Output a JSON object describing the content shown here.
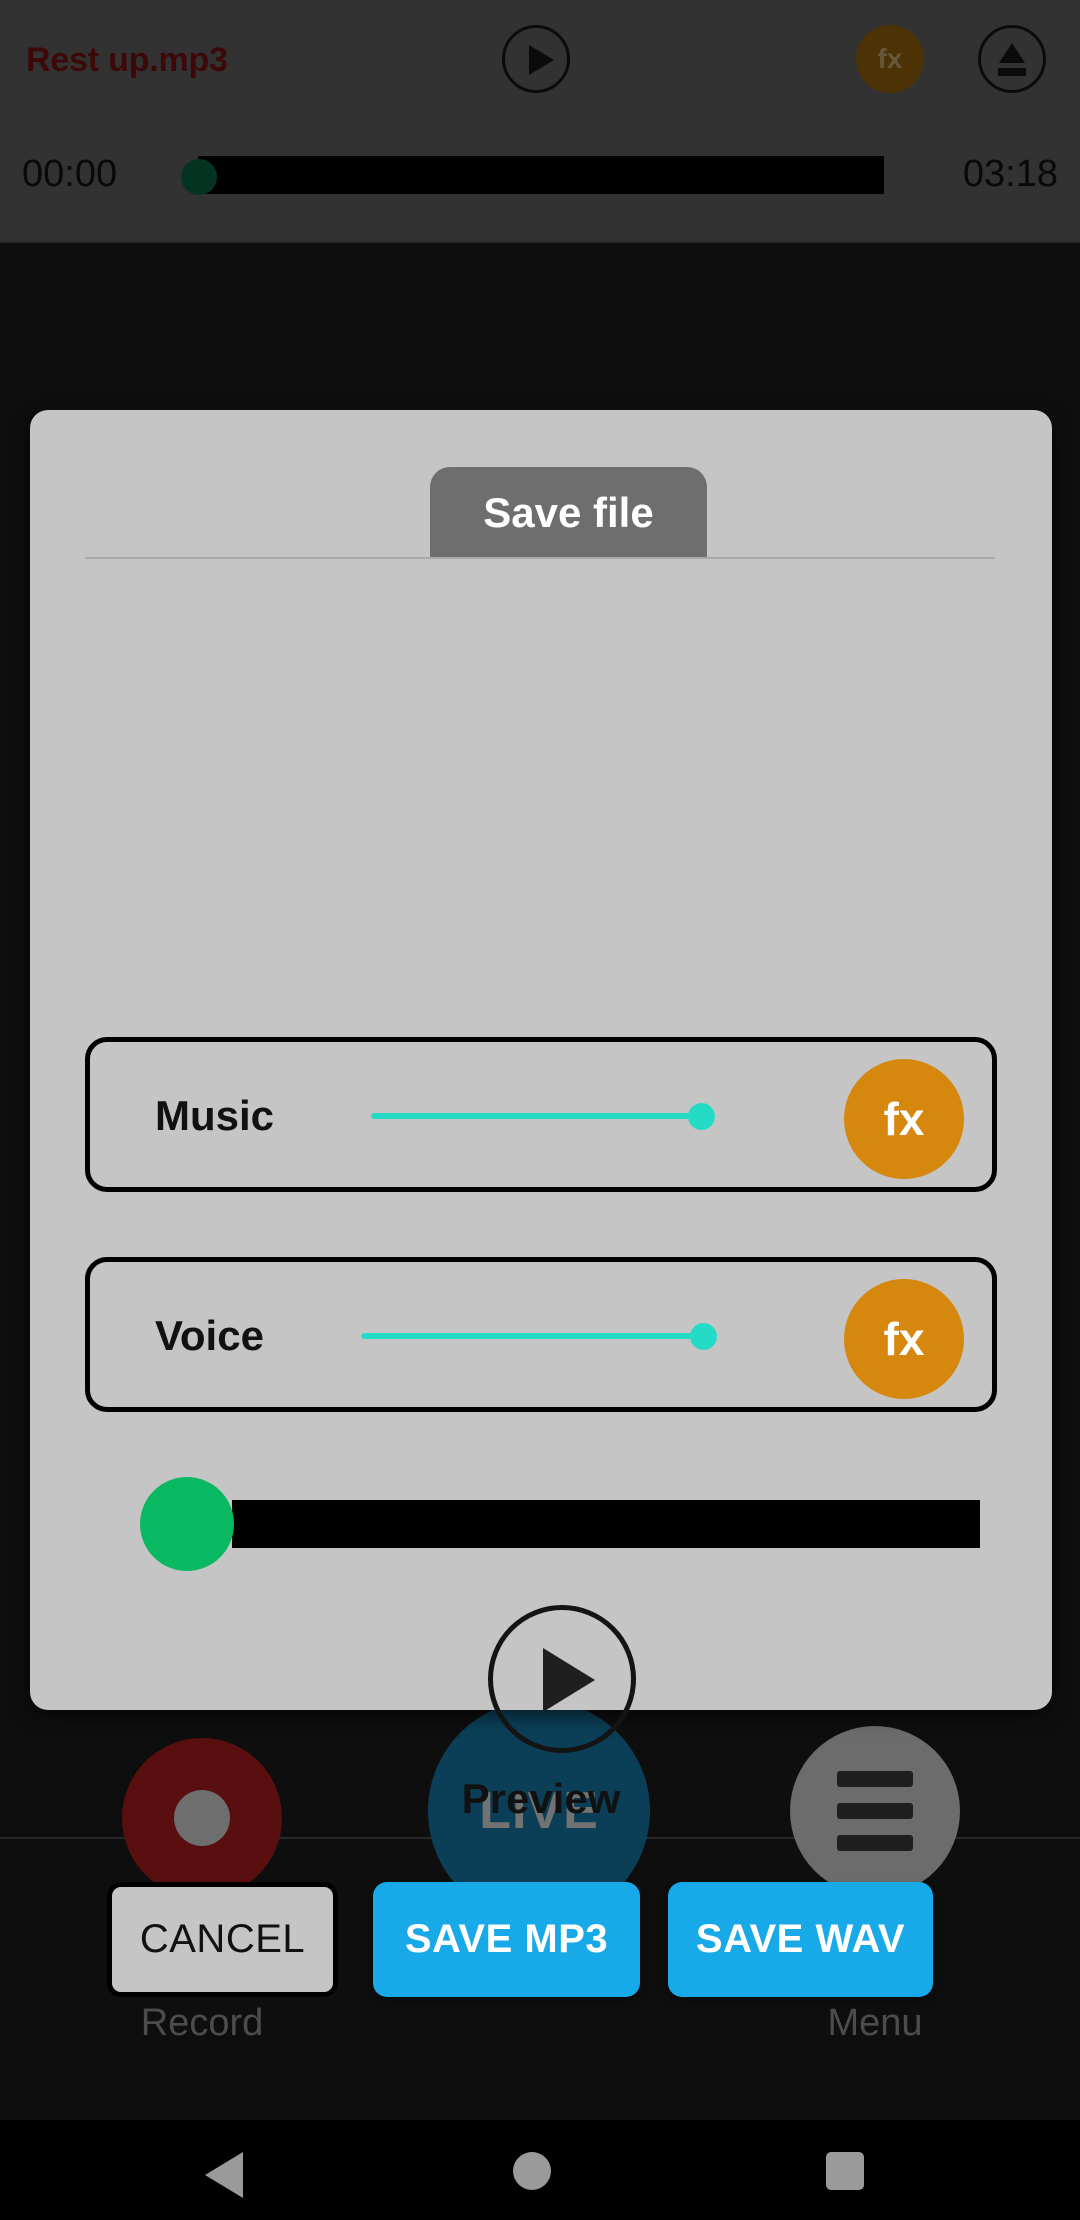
{
  "player": {
    "track_title": "Rest up.mp3",
    "play_icon": "play-icon",
    "fx_label": "fx",
    "eject_icon": "eject-icon",
    "time_current": "00:00",
    "time_total": "03:18",
    "seek_position_percent": 0,
    "thumb_color": "#07603d",
    "bar_color": "#000000",
    "background_color": "#5c5c5c",
    "title_color": "#6e0f0f"
  },
  "dialog": {
    "tab_label": "Save file",
    "background_color": "#c5c5c5",
    "tab_background_color": "#6e6e6e",
    "tracks": [
      {
        "label": "Music",
        "slider_value_percent": 100,
        "slider_color": "#24dbc6",
        "fx_label": "fx",
        "fx_color": "#d6880e"
      },
      {
        "label": "Voice",
        "slider_value_percent": 100,
        "slider_color": "#24dbc6",
        "fx_label": "fx",
        "fx_color": "#d6880e"
      }
    ],
    "preview_seek": {
      "position_percent": 0,
      "thumb_color": "#09b961",
      "bar_color": "#000000"
    },
    "preview": {
      "label": "Preview",
      "icon": "play-icon"
    },
    "actions": {
      "cancel_label": "CANCEL",
      "save_mp3_label": "SAVE MP3",
      "save_wav_label": "SAVE WAV",
      "primary_color": "#17a9e8"
    }
  },
  "bottom_nav": {
    "record_label": "Record",
    "live_label": "LIVE",
    "menu_label": "Menu",
    "record_color": "#a31c1c",
    "live_color": "#1573a0",
    "menu_color": "#c5c5c5"
  },
  "system_nav": {
    "back_icon": "back-triangle-icon",
    "home_icon": "home-circle-icon",
    "recents_icon": "recents-square-icon"
  }
}
